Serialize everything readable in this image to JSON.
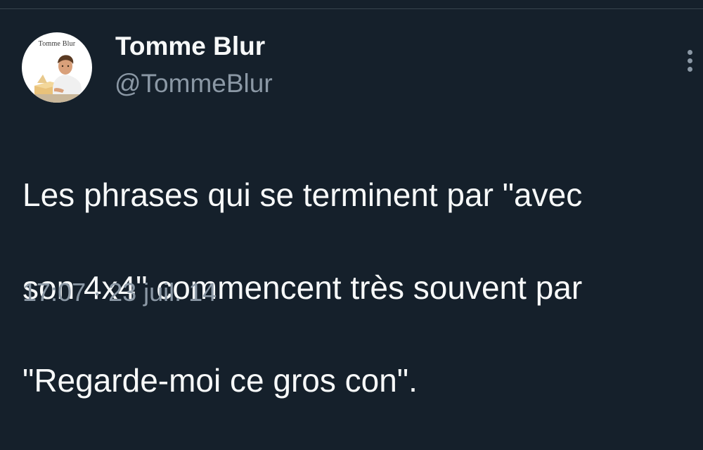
{
  "colors": {
    "background": "#15202b",
    "primary_text": "#f7f9f9",
    "secondary_text": "#8b98a5",
    "divider": "#38444d"
  },
  "tweet": {
    "avatar": {
      "label_text": "Tomme Blur",
      "icon": "profile-photo"
    },
    "author": {
      "display_name": "Tomme Blur",
      "handle": "@TommeBlur"
    },
    "more_icon": "three-dots-vertical-icon",
    "text_lines": [
      "Les phrases qui se terminent par \"avec",
      "son 4x4\" commencent très souvent par",
      "\"Regarde-moi ce gros con\"."
    ],
    "timestamp": "17:07 · 23 juil. 14"
  }
}
